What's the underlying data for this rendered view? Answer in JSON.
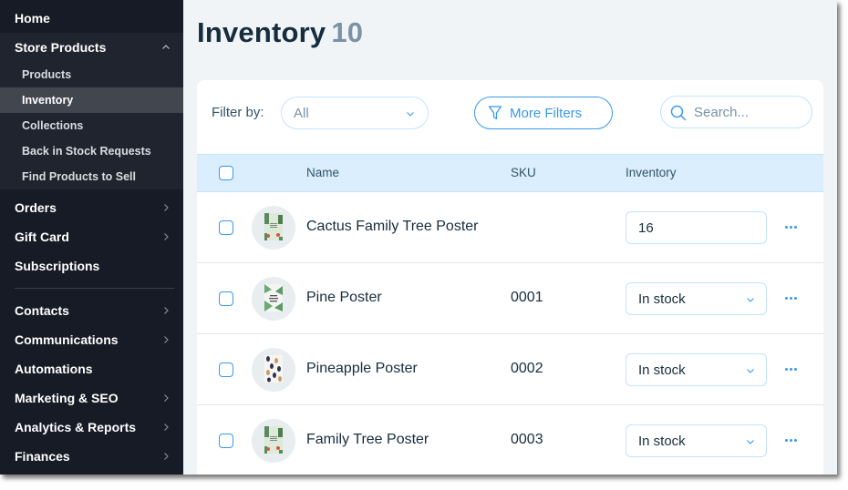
{
  "sidebar": {
    "home": "Home",
    "store_products": {
      "label": "Store Products",
      "expanded": true,
      "children": [
        {
          "label": "Products",
          "active": false
        },
        {
          "label": "Inventory",
          "active": true
        },
        {
          "label": "Collections",
          "active": false
        },
        {
          "label": "Back in Stock Requests",
          "active": false
        },
        {
          "label": "Find Products to Sell",
          "active": false
        }
      ]
    },
    "items_group1": [
      {
        "label": "Orders",
        "has_submenu": true
      },
      {
        "label": "Gift Card",
        "has_submenu": true
      },
      {
        "label": "Subscriptions",
        "has_submenu": false
      }
    ],
    "items_group2": [
      {
        "label": "Contacts",
        "has_submenu": true
      },
      {
        "label": "Communications",
        "has_submenu": true
      },
      {
        "label": "Automations",
        "has_submenu": false
      },
      {
        "label": "Marketing & SEO",
        "has_submenu": true
      },
      {
        "label": "Analytics & Reports",
        "has_submenu": true
      },
      {
        "label": "Finances",
        "has_submenu": true
      }
    ]
  },
  "page": {
    "title": "Inventory",
    "count": "10"
  },
  "toolbar": {
    "filter_label": "Filter by:",
    "filter_value": "All",
    "more_filters": "More Filters",
    "search_placeholder": "Search..."
  },
  "table": {
    "columns": [
      "Name",
      "SKU",
      "Inventory"
    ],
    "rows": [
      {
        "name": "Cactus Family Tree Poster",
        "sku": "",
        "inventory_type": "number",
        "inventory": "16",
        "thumb": "cactus"
      },
      {
        "name": "Pine Poster",
        "sku": "0001",
        "inventory_type": "status",
        "inventory": "In stock",
        "thumb": "pine"
      },
      {
        "name": "Pineapple Poster",
        "sku": "0002",
        "inventory_type": "status",
        "inventory": "In stock",
        "thumb": "pineapple"
      },
      {
        "name": "Family Tree Poster",
        "sku": "0003",
        "inventory_type": "status",
        "inventory": "In stock",
        "thumb": "cactus"
      }
    ]
  },
  "colors": {
    "sidebar_bg": "#161b25",
    "accent": "#3899ec",
    "header_row_bg": "#daeefd",
    "title_text": "#162d3d"
  }
}
